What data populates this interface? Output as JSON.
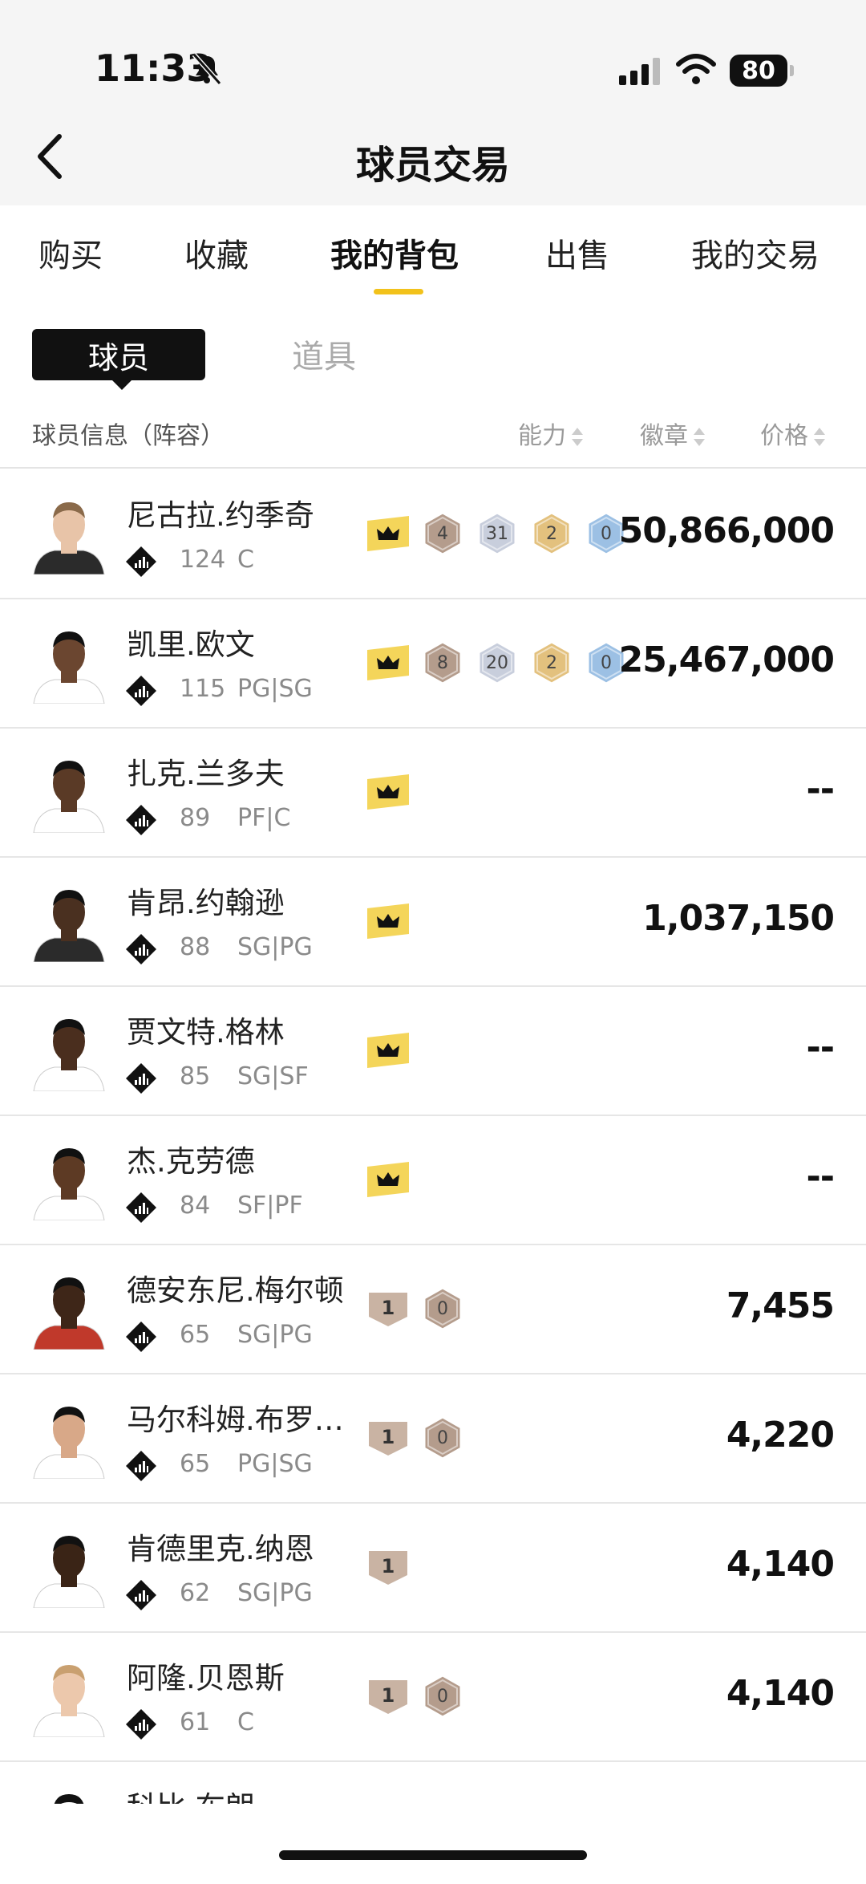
{
  "status": {
    "time": "11:33",
    "battery": "80"
  },
  "header": {
    "title": "球员交易"
  },
  "tabs": [
    {
      "label": "购买"
    },
    {
      "label": "收藏"
    },
    {
      "label": "我的背包"
    },
    {
      "label": "出售"
    },
    {
      "label": "我的交易"
    }
  ],
  "segment": {
    "player": "球员",
    "items": "道具"
  },
  "table_header": {
    "info": "球员信息（阵容）",
    "ability": "能力",
    "badge": "徽章",
    "price": "价格"
  },
  "players": [
    {
      "name": "尼古拉.约季奇",
      "ovr": "124",
      "pos": "C",
      "crown": true,
      "hexes": [
        "4",
        "31",
        "2",
        "0"
      ],
      "price": "50,866,000"
    },
    {
      "name": "凯里.欧文",
      "ovr": "115",
      "pos": "PG|SG",
      "crown": true,
      "hexes": [
        "8",
        "20",
        "2",
        "0"
      ],
      "price": "25,467,000"
    },
    {
      "name": "扎克.兰多夫",
      "ovr": "89",
      "pos": "PF|C",
      "crown": true,
      "hexes": [],
      "price": "--"
    },
    {
      "name": "肯昂.约翰逊",
      "ovr": "88",
      "pos": "SG|PG",
      "crown": true,
      "hexes": [],
      "price": "1,037,150"
    },
    {
      "name": "贾文特.格林",
      "ovr": "85",
      "pos": "SG|SF",
      "crown": true,
      "hexes": [],
      "price": "--"
    },
    {
      "name": "杰.克劳德",
      "ovr": "84",
      "pos": "SF|PF",
      "crown": true,
      "hexes": [],
      "price": "--"
    },
    {
      "name": "德安东尼.梅尔顿",
      "ovr": "65",
      "pos": "SG|PG",
      "crown": false,
      "shield": "1",
      "hexes": [
        "0"
      ],
      "price": "7,455"
    },
    {
      "name": "马尔科姆.布罗…",
      "ovr": "65",
      "pos": "PG|SG",
      "crown": false,
      "shield": "1",
      "hexes": [
        "0"
      ],
      "price": "4,220"
    },
    {
      "name": "肯德里克.纳恩",
      "ovr": "62",
      "pos": "SG|PG",
      "crown": false,
      "shield": "1",
      "hexes": [],
      "price": "4,140"
    },
    {
      "name": "阿隆.贝恩斯",
      "ovr": "61",
      "pos": "C",
      "crown": false,
      "shield": "1",
      "hexes": [
        "0"
      ],
      "price": "4,140"
    }
  ],
  "partial_player": {
    "name": "科比.布朗"
  },
  "colors": {
    "accent": "#f2c21b",
    "crown_bg": "#f4d55a",
    "hex_bronze": "#b49c8c",
    "hex_silver": "#c8cedc",
    "hex_gold": "#e3c17e",
    "hex_blue": "#9cc0e4"
  }
}
